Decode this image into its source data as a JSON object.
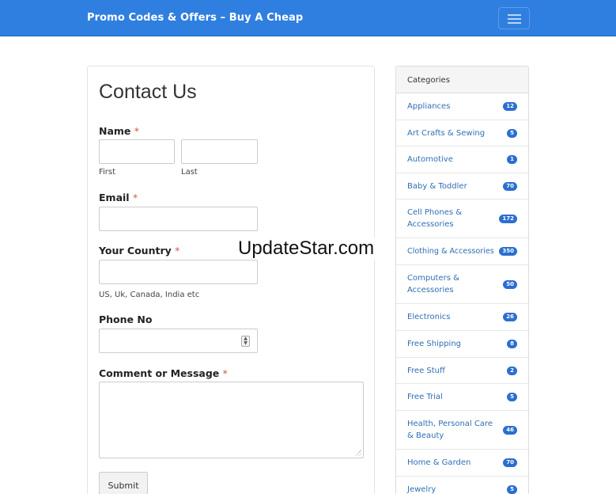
{
  "navbar": {
    "brand": "Promo Codes & Offers – Buy A Cheap"
  },
  "form": {
    "title": "Contact Us",
    "name_label": "Name",
    "first_hint": "First",
    "last_hint": "Last",
    "email_label": "Email",
    "country_label": "Your Country",
    "country_hint": "US, Uk, Canada, India etc",
    "phone_label": "Phone No",
    "comment_label": "Comment or Message",
    "required_mark": "*",
    "submit_label": "Submit"
  },
  "watermark": "UpdateStar.com",
  "sidebar": {
    "heading": "Categories",
    "items": [
      {
        "label": "Appliances",
        "count": "12"
      },
      {
        "label": "Art Crafts & Sewing",
        "count": "5"
      },
      {
        "label": "Automotive",
        "count": "1"
      },
      {
        "label": "Baby & Toddler",
        "count": "70"
      },
      {
        "label": "Cell Phones & Accessories",
        "count": "172"
      },
      {
        "label": "Clothing & Accessories",
        "count": "350"
      },
      {
        "label": "Computers & Accessories",
        "count": "50"
      },
      {
        "label": "Electronics",
        "count": "26"
      },
      {
        "label": "Free Shipping",
        "count": "8"
      },
      {
        "label": "Free Stuff",
        "count": "2"
      },
      {
        "label": "Free Trial",
        "count": "5"
      },
      {
        "label": "Health, Personal Care & Beauty",
        "count": "46"
      },
      {
        "label": "Home & Garden",
        "count": "70"
      },
      {
        "label": "Jewelry",
        "count": "5"
      }
    ]
  },
  "colors": {
    "brand_blue": "#2f7fe0",
    "badge_blue": "#2b6ed0",
    "link_blue": "#2f6fb5",
    "required_red": "#d9534f"
  }
}
